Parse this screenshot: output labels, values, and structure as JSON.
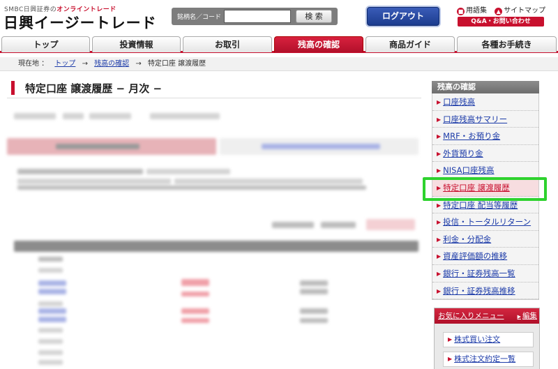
{
  "header": {
    "brand_prefix": "SMBC日興証券の",
    "brand_highlight": "オンライントレード",
    "brand_name": "日興イージートレード",
    "search_label": "銘柄名／コード",
    "search_value": "",
    "search_button": "検 索",
    "logout_button": "ログアウト",
    "glossary_icon": "book-icon",
    "glossary_label": "用語集",
    "sitemap_icon": "sitemap-icon",
    "sitemap_label": "サイトマップ",
    "qa_button": "Q&A・お問い合わせ"
  },
  "nav": {
    "tabs": [
      "トップ",
      "投資情報",
      "お取引",
      "残高の確認",
      "商品ガイド",
      "各種お手続き"
    ],
    "active_index": 3
  },
  "breadcrumb": {
    "prefix": "現在地 ：",
    "items": [
      "トップ",
      "残高の確認",
      "特定口座 譲渡履歴"
    ],
    "separator": "→"
  },
  "main": {
    "title": "特定口座 譲渡履歴 − 月次 −"
  },
  "sidebar": {
    "heading": "残高の確認",
    "items": [
      "口座残高",
      "口座残高サマリー",
      "MRF・お預り金",
      "外貨預り金",
      "NISA口座残高",
      "特定口座 譲渡履歴",
      "特定口座 配当等履歴",
      "投信・トータルリターン",
      "利金・分配金",
      "資産評価額の推移",
      "銀行・証券残高一覧",
      "銀行・証券残高推移"
    ],
    "current_index": 5,
    "favorites": {
      "heading": "お気に入りメニュー",
      "edit_label": "編集",
      "items": [
        "株式買い注文",
        "株式注文約定一覧"
      ]
    }
  },
  "colors": {
    "accent_red": "#c8102e",
    "link_blue": "#1b3aa8",
    "logout_blue": "#1c3c8e",
    "highlight_green": "#2ed22e"
  }
}
